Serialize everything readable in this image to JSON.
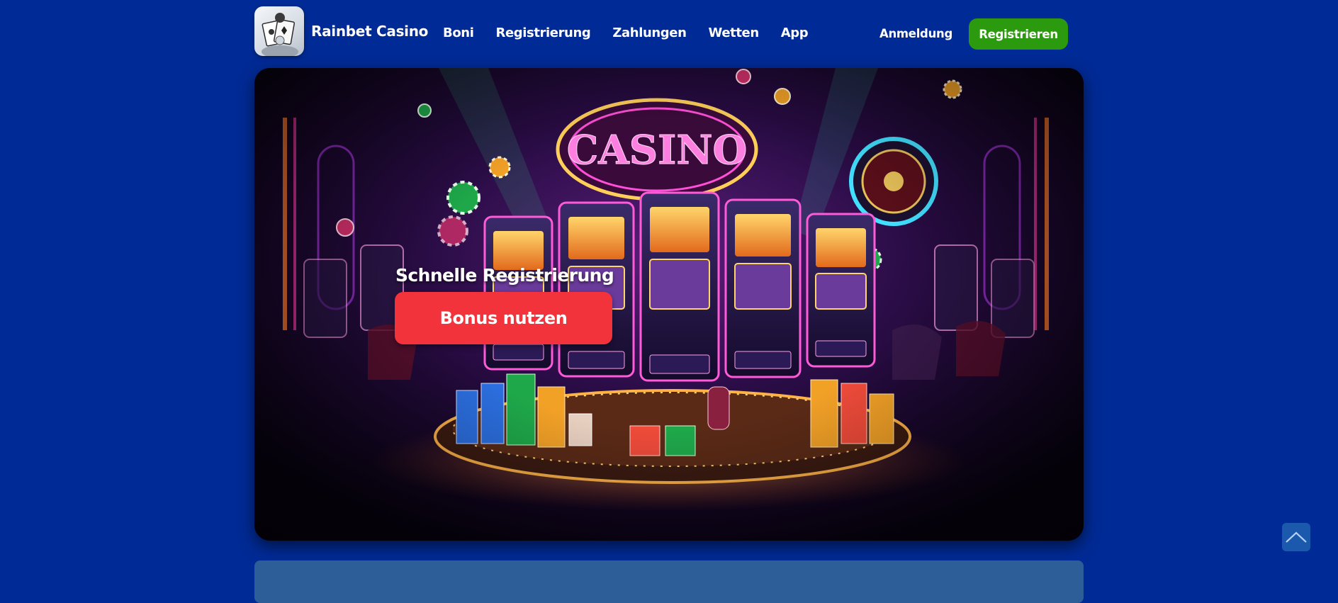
{
  "header": {
    "brand": "Rainbet Casino",
    "logo_icon": "card-dealer-logo-icon",
    "nav": [
      {
        "label": "Boni"
      },
      {
        "label": "Registrierung"
      },
      {
        "label": "Zahlungen"
      },
      {
        "label": "Wetten"
      },
      {
        "label": "App"
      }
    ],
    "login_label": "Anmeldung",
    "register_label": "Registrieren"
  },
  "hero": {
    "image": "neon-casino-slot-machines-image",
    "title": "Schnelle Registrierung",
    "cta_label": "Bonus nutzen"
  },
  "scroll_top": {
    "icon": "chevron-up-icon"
  },
  "colors": {
    "page_background": "#002a95",
    "register_button": "#2c9a0e",
    "bonus_button": "#f3333b",
    "lower_panel": "#2e5e98"
  }
}
